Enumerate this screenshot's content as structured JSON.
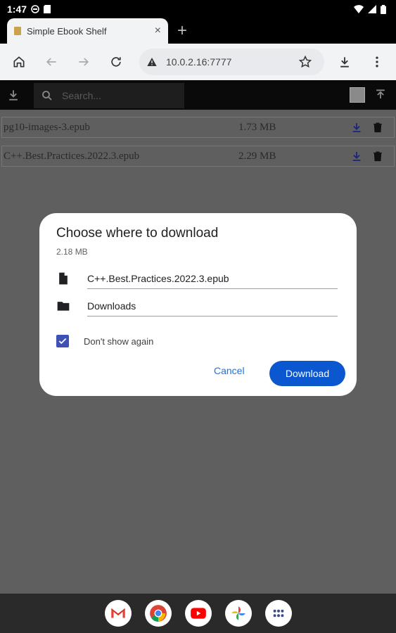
{
  "status_bar": {
    "time": "1:47"
  },
  "tab": {
    "title": "Simple Ebook Shelf",
    "close": "×",
    "new_tab": "+"
  },
  "toolbar": {
    "url": "10.0.2.16:7777"
  },
  "app": {
    "search_placeholder": "Search...",
    "books": [
      {
        "name": "pg10-images-3.epub",
        "size": "1.73 MB"
      },
      {
        "name": "C++.Best.Practices.2022.3.epub",
        "size": "2.29 MB"
      }
    ]
  },
  "dialog": {
    "title": "Choose where to download",
    "size": "2.18 MB",
    "filename": "C++.Best.Practices.2022.3.epub",
    "folder": "Downloads",
    "checkbox_label": "Don't show again",
    "cancel_label": "Cancel",
    "download_label": "Download"
  },
  "colors": {
    "accent": "#0b57d0",
    "overlay": "#5f5f5f",
    "checkbox": "#3f51b5"
  }
}
